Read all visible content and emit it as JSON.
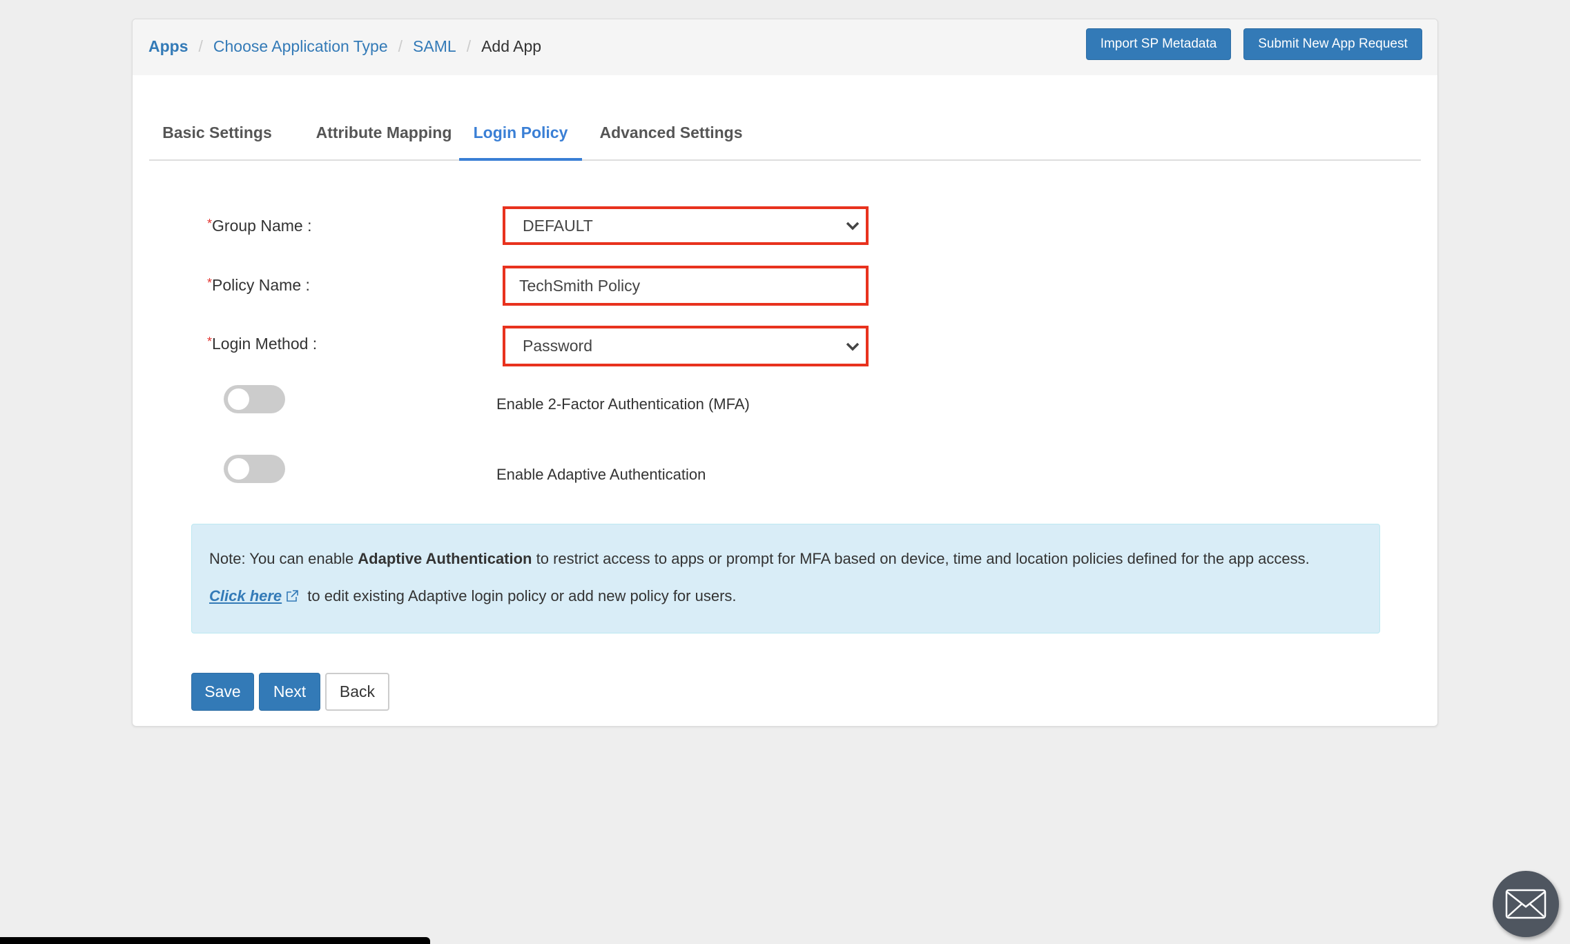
{
  "breadcrumb": {
    "items": [
      {
        "label": "Apps"
      },
      {
        "label": "Choose Application Type"
      },
      {
        "label": "SAML"
      },
      {
        "label": "Add App"
      }
    ],
    "separator": "/"
  },
  "header_actions": {
    "import_label": "Import SP Metadata",
    "submit_label": "Submit New App Request"
  },
  "tabs": [
    {
      "label": "Basic Settings",
      "active": false
    },
    {
      "label": "Attribute Mapping",
      "active": false
    },
    {
      "label": "Login Policy",
      "active": true
    },
    {
      "label": "Advanced Settings",
      "active": false
    }
  ],
  "form": {
    "required_mark": "*",
    "group_name": {
      "label": "Group Name :",
      "value": "DEFAULT"
    },
    "policy_name": {
      "label": "Policy Name :",
      "value": "TechSmith Policy"
    },
    "login_method": {
      "label": "Login Method :",
      "value": "Password"
    },
    "mfa_toggle": {
      "label": "Enable 2-Factor Authentication (MFA)",
      "enabled": false
    },
    "adaptive_toggle": {
      "label": "Enable Adaptive Authentication",
      "enabled": false
    },
    "highlight_color": "#e8321e"
  },
  "note": {
    "prefix": "Note: You can enable ",
    "bold": "Adaptive Authentication",
    "suffix": " to restrict access to apps or prompt for MFA based on device, time and location policies defined for the app access.",
    "link_label": "Click here",
    "link_suffix": " to edit existing Adaptive login policy or add new policy for users."
  },
  "footer_actions": {
    "save_label": "Save",
    "next_label": "Next",
    "back_label": "Back"
  },
  "colors": {
    "primary": "#337ab7",
    "active_tab": "#3a7fd5",
    "note_bg": "#d9edf7"
  },
  "icons": {
    "select_arrow": "chevron-down-icon",
    "external_link": "external-link-icon",
    "mail": "envelope-icon"
  }
}
